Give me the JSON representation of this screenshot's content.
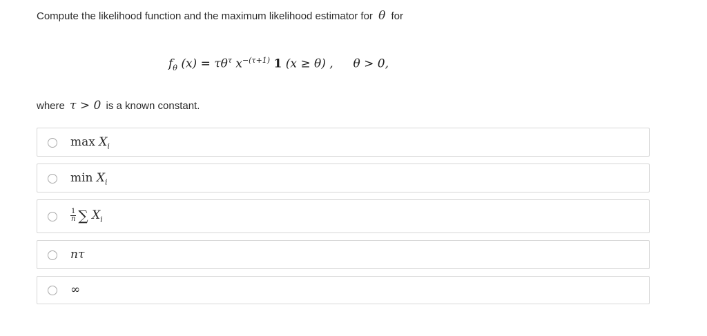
{
  "question": {
    "text_before": "Compute the likelihood function and the maximum likelihood estimator for",
    "theta_symbol": "θ",
    "text_after": "for"
  },
  "formula": {
    "f": "f",
    "f_sub": "θ",
    "arg": "(x) = τθ",
    "tau_exp": "τ",
    "x": "x",
    "x_exp": "−(τ+1)",
    "indicator": "1",
    "cond": "(x ≥ θ) ,",
    "domain": "θ > 0,"
  },
  "where": {
    "text_before": "where",
    "condition": "τ > 0",
    "text_after": "is a known constant."
  },
  "options": [
    {
      "op": "max",
      "var": "X",
      "sub": "i"
    },
    {
      "op": "min",
      "var": "X",
      "sub": "i"
    },
    {
      "frac_num": "1",
      "frac_den": "n",
      "sigma": "∑",
      "var": "X",
      "sub": "i"
    },
    {
      "expr": "nτ"
    },
    {
      "expr": "∞"
    }
  ]
}
